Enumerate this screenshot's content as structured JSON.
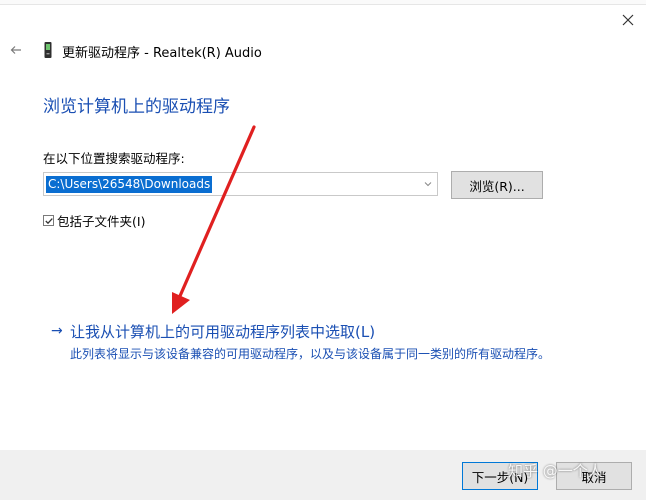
{
  "window": {
    "title": "更新驱动程序 - Realtek(R) Audio",
    "back_icon": "back-arrow-icon",
    "close_icon": "close-icon"
  },
  "page": {
    "heading": "浏览计算机上的驱动程序",
    "search_label": "在以下位置搜索驱动程序:",
    "path_value": "C:\\Users\\26548\\Downloads",
    "browse_label": "浏览(R)...",
    "include_subfolders_label": "包括子文件夹(I)",
    "include_subfolders_checked": true,
    "pick_arrow": "→",
    "pick_link": "让我从计算机上的可用驱动程序列表中选取(L)",
    "pick_description": "此列表将显示与该设备兼容的可用驱动程序，以及与该设备属于同一类别的所有驱动程序。"
  },
  "footer": {
    "next_label": "下一步(N)",
    "cancel_label": "取消"
  },
  "watermark": "知乎 @一个人",
  "colors": {
    "link_blue": "#1a4fb3",
    "selection_blue": "#0a6ed1",
    "annotation_red": "#e02020"
  }
}
